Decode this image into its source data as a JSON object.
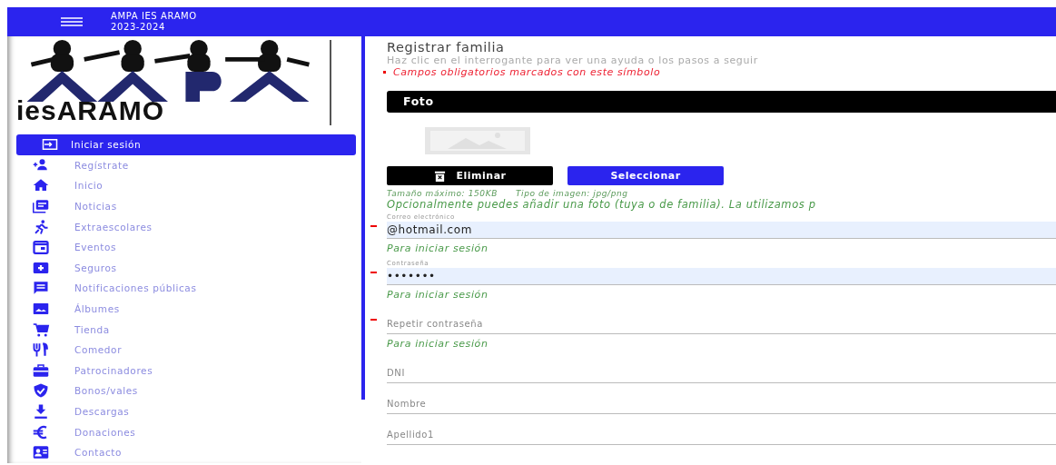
{
  "header": {
    "title": "AMPA IES ARAMO",
    "subtitle": "2023-2024"
  },
  "logo": {
    "text": "iesARAMO"
  },
  "sidebar": {
    "items": [
      {
        "label": "Iniciar sesión",
        "selected": true
      },
      {
        "label": "Regístrate",
        "selected": false
      },
      {
        "label": "Inicio",
        "selected": false
      },
      {
        "label": "Noticias",
        "selected": false
      },
      {
        "label": "Extraescolares",
        "selected": false
      },
      {
        "label": "Eventos",
        "selected": false
      },
      {
        "label": "Seguros",
        "selected": false
      },
      {
        "label": "Notificaciones públicas",
        "selected": false
      },
      {
        "label": "Álbumes",
        "selected": false
      },
      {
        "label": "Tienda",
        "selected": false
      },
      {
        "label": "Comedor",
        "selected": false
      },
      {
        "label": "Patrocinadores",
        "selected": false
      },
      {
        "label": "Bonos/vales",
        "selected": false
      },
      {
        "label": "Descargas",
        "selected": false
      },
      {
        "label": "Donaciones",
        "selected": false
      },
      {
        "label": "Contacto",
        "selected": false
      }
    ]
  },
  "main": {
    "title": "Registrar familia",
    "help": "Haz clic en el interrogante para ver una ayuda o los pasos a seguir",
    "required_note": "Campos obligatorios marcados con este símbolo",
    "photo": {
      "heading": "Foto",
      "delete_button": "Eliminar",
      "select_button": "Seleccionar",
      "limits": "Tamaño máximo: 150KB",
      "types": "Tipo de imagen: jpg/png",
      "note": "Opcionalmente puedes añadir una foto (tuya o de familia). La utilizamos p"
    },
    "fields": [
      {
        "label": "Correo electrónico",
        "value": "@hotmail.com",
        "required": true,
        "hint": "Para iniciar sesión"
      },
      {
        "label": "Contraseña",
        "value": "•••••••",
        "required": true,
        "hint": "Para iniciar sesión"
      },
      {
        "placeholder": "Repetir contraseña",
        "required": true,
        "hint": "Para iniciar sesión"
      },
      {
        "placeholder": "DNI",
        "required": false
      },
      {
        "placeholder": "Nombre",
        "required": false
      },
      {
        "placeholder": "Apellido1",
        "required": false
      }
    ]
  }
}
